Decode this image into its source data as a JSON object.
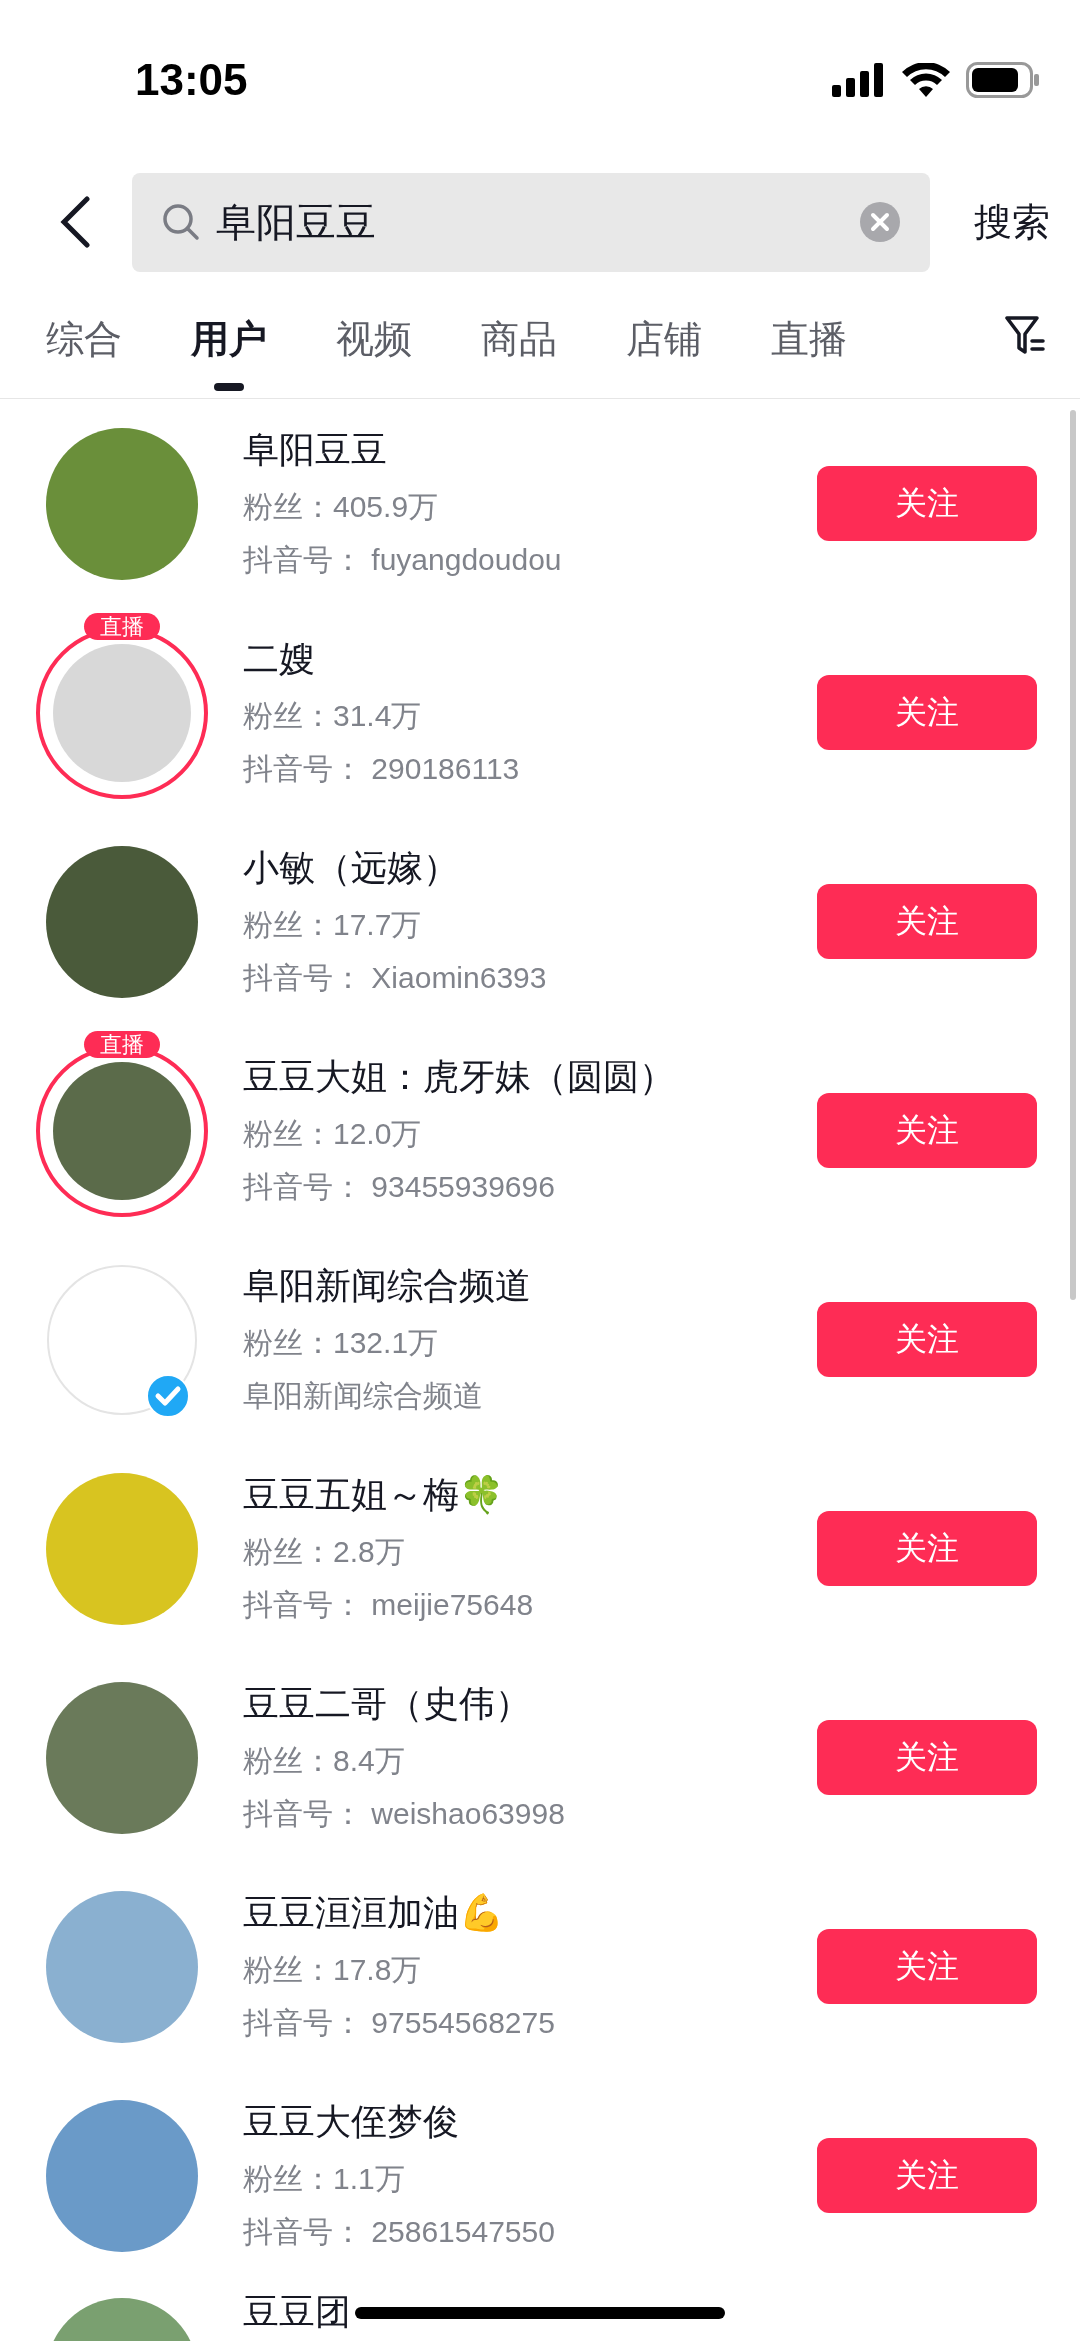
{
  "status_bar": {
    "time": "13:05"
  },
  "search": {
    "value": "阜阳豆豆",
    "button": "搜索"
  },
  "tabs": [
    {
      "label": "综合",
      "selected": false
    },
    {
      "label": "用户",
      "selected": true
    },
    {
      "label": "视频",
      "selected": false
    },
    {
      "label": "商品",
      "selected": false
    },
    {
      "label": "店铺",
      "selected": false
    },
    {
      "label": "直播",
      "selected": false
    }
  ],
  "users": [
    {
      "name": "阜阳豆豆",
      "fans": "粉丝：405.9万",
      "detail": "抖音号： fuyangdoudou",
      "live": false,
      "verified": false,
      "button": "关注"
    },
    {
      "name": "二嫂",
      "fans": "粉丝：31.4万",
      "detail": "抖音号： 290186113",
      "live": true,
      "live_label": "直播",
      "verified": false,
      "button": "关注"
    },
    {
      "name": "小敏（远嫁）",
      "fans": "粉丝：17.7万",
      "detail": "抖音号： Xiaomin6393",
      "live": false,
      "verified": false,
      "button": "关注"
    },
    {
      "name": "豆豆大姐：虎牙妹（圆圆）",
      "fans": "粉丝：12.0万",
      "detail": "抖音号： 93455939696",
      "live": true,
      "live_label": "直播",
      "verified": false,
      "button": "关注"
    },
    {
      "name": "阜阳新闻综合频道",
      "fans": "粉丝：132.1万",
      "detail": "阜阳新闻综合频道",
      "live": false,
      "verified": true,
      "button": "关注"
    },
    {
      "name": "豆豆五姐～梅🍀",
      "fans": "粉丝：2.8万",
      "detail": "抖音号： meijie75648",
      "live": false,
      "verified": false,
      "button": "关注"
    },
    {
      "name": "豆豆二哥（史伟）",
      "fans": "粉丝：8.4万",
      "detail": "抖音号： weishao63998",
      "live": false,
      "verified": false,
      "button": "关注"
    },
    {
      "name": "豆豆洹洹加油💪",
      "fans": "粉丝：17.8万",
      "detail": "抖音号： 97554568275",
      "live": false,
      "verified": false,
      "button": "关注"
    },
    {
      "name": "豆豆大侄梦俊",
      "fans": "粉丝：1.1万",
      "detail": "抖音号： 25861547550",
      "live": false,
      "verified": false,
      "button": "关注"
    },
    {
      "name": "豆豆团",
      "live": false,
      "verified": false
    }
  ]
}
